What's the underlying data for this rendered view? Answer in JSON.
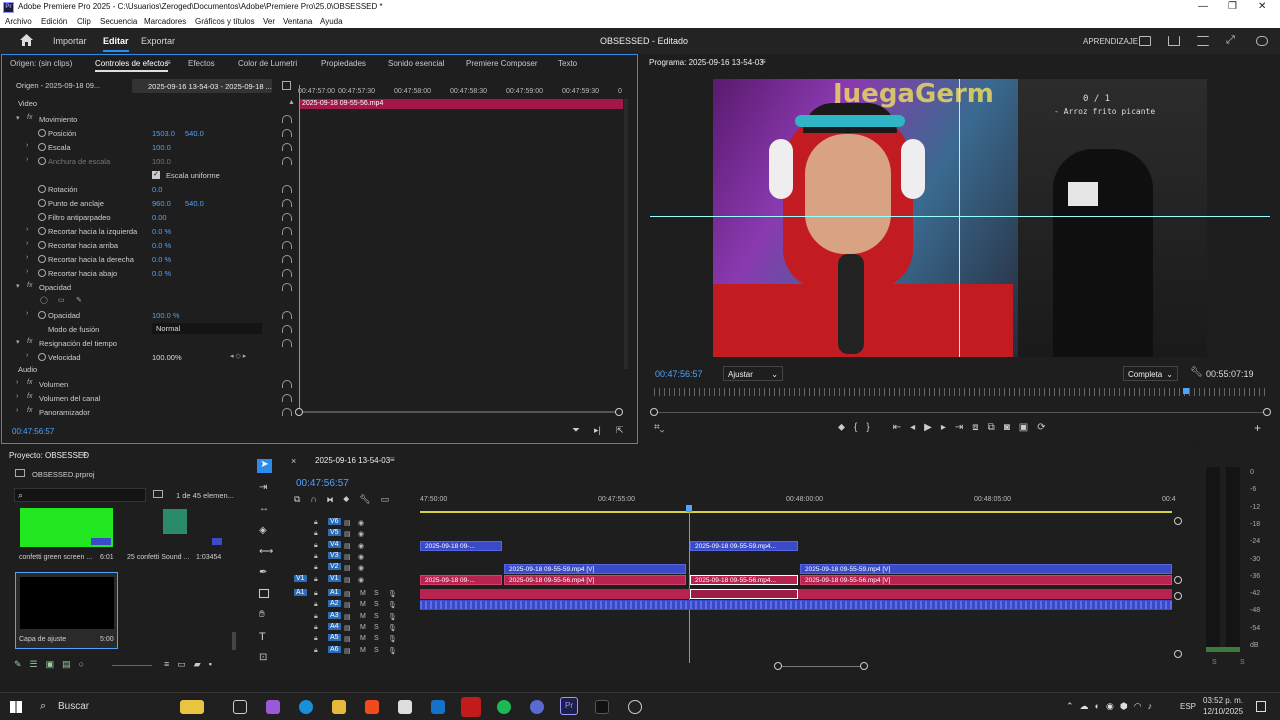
{
  "titlebar": {
    "title": "Adobe Premiere Pro 2025 - C:\\Usuarios\\Zeroged\\Documentos\\Adobe\\Premiere Pro\\25.0\\OBSESSED *"
  },
  "menu": [
    "Archivo",
    "Edición",
    "Clip",
    "Secuencia",
    "Marcadores",
    "Gráficos y títulos",
    "Ver",
    "Ventana",
    "Ayuda"
  ],
  "workspaces": {
    "importar": "Importar",
    "editar": "Editar",
    "exportar": "Exportar",
    "project_title": "OBSESSED - Editado",
    "aprendizaje": "APRENDIZAJE"
  },
  "panel_tabs": [
    "Origen: (sin clips)",
    "Controles de efectos",
    "Efectos",
    "Color de Lumetri",
    "Propiedades",
    "Sonido esencial",
    "Premiere Composer",
    "Texto"
  ],
  "effect_controls": {
    "source_tab": "Origen - 2025-09-18 09...",
    "seq_tab": "2025-09-16 13-54-03 - 2025-09-18 ...",
    "ruler": [
      "00:47:57:00",
      "00:47:57:30",
      "00:47:58:00",
      "00:47:58:30",
      "00:47:59:00",
      "00:47:59:30",
      "0"
    ],
    "clip_name": "2025-09-18 09-55-56.mp4",
    "video_header": "Video",
    "audio_header": "Audio",
    "timecode": "00:47:56:57",
    "rows": [
      {
        "label": "Movimiento",
        "fx": true
      },
      {
        "label": "Posición",
        "v1": "1503.0",
        "v2": "540.0"
      },
      {
        "label": "Escala",
        "v1": "100.0"
      },
      {
        "label": "Anchura de escala",
        "v1": "100.0"
      },
      {
        "label": "Escala uniforme"
      },
      {
        "label": "Rotación",
        "v1": "0.0"
      },
      {
        "label": "Punto de anclaje",
        "v1": "960.0",
        "v2": "540.0"
      },
      {
        "label": "Filtro antiparpadeo",
        "v1": "0.00"
      },
      {
        "label": "Recortar hacia la izquierda",
        "v1": "0.0 %"
      },
      {
        "label": "Recortar hacia arriba",
        "v1": "0.0 %"
      },
      {
        "label": "Recortar hacia la derecha",
        "v1": "0.0 %"
      },
      {
        "label": "Recortar hacia abajo",
        "v1": "0.0 %"
      },
      {
        "label": "Opacidad",
        "fx": true
      },
      {
        "label": ""
      },
      {
        "label": "Opacidad",
        "v1": "100.0 %"
      },
      {
        "label": "Modo de fusión",
        "v1": "Normal"
      },
      {
        "label": "Resignación del tiempo",
        "fx": true
      },
      {
        "label": "Velocidad",
        "v1": "100.00%"
      }
    ],
    "audio_rows": [
      "Volumen",
      "Volumen del canal",
      "Panoramizador"
    ]
  },
  "program": {
    "title": "Programa: 2025-09-16 13-54-03",
    "timecode": "00:47:56:57",
    "fit": "Ajustar",
    "quality": "Completa",
    "duration": "00:55:07:19",
    "overlay_counter": "0 / 1",
    "overlay_text": "- Arroz frito picante",
    "banner_text": "JuegaGerm"
  },
  "project": {
    "title": "Proyecto: OBSESSED",
    "file": "OBSESSED.prproj",
    "count": "1 de 45 elemen...",
    "items": [
      {
        "name": "confetti green screen ...",
        "dur": "6:01"
      },
      {
        "name": "25 confetti Sound ...",
        "dur": "1:03454"
      },
      {
        "name": "Capa de ajuste",
        "dur": "5:00"
      }
    ]
  },
  "timeline": {
    "seq": "2025-09-16 13-54-03",
    "timecode": "00:47:56:57",
    "ruler": [
      "47:50:00",
      "00:47:55:00",
      "00:48:00:00",
      "00:48:05:00",
      "00:4"
    ],
    "video_tracks": [
      "V6",
      "V5",
      "V4",
      "V3",
      "V2",
      "V1"
    ],
    "audio_tracks": [
      "A1",
      "A2",
      "A3",
      "A4",
      "A5",
      "A6"
    ],
    "src_v": "V1",
    "src_a": "A1",
    "clips": {
      "v4a": "2025-09-18 09-...",
      "v4b": "2025-09-18 09-55-59.mp4...",
      "v2a": "2025-09-18 09-55-59.mp4 [V]",
      "v2b": "2025-09-18 09-55-59.mp4 [V]",
      "v1a": "2025-09-18 09-...",
      "v1b": "2025-09-18 09-55-56.mp4 [V]",
      "v1c": "2025-09-18 09-55-56.mp4...",
      "v1d": "2025-09-18 09-55-56.mp4 [V]"
    }
  },
  "meters": [
    "0",
    "-6",
    "-12",
    "-18",
    "-24",
    "-30",
    "-36",
    "-42",
    "-48",
    "-54",
    "dB"
  ],
  "taskbar": {
    "search": "Buscar",
    "lang": "ESP",
    "time": "03:52 p. m.",
    "date": "12/10/2025"
  }
}
